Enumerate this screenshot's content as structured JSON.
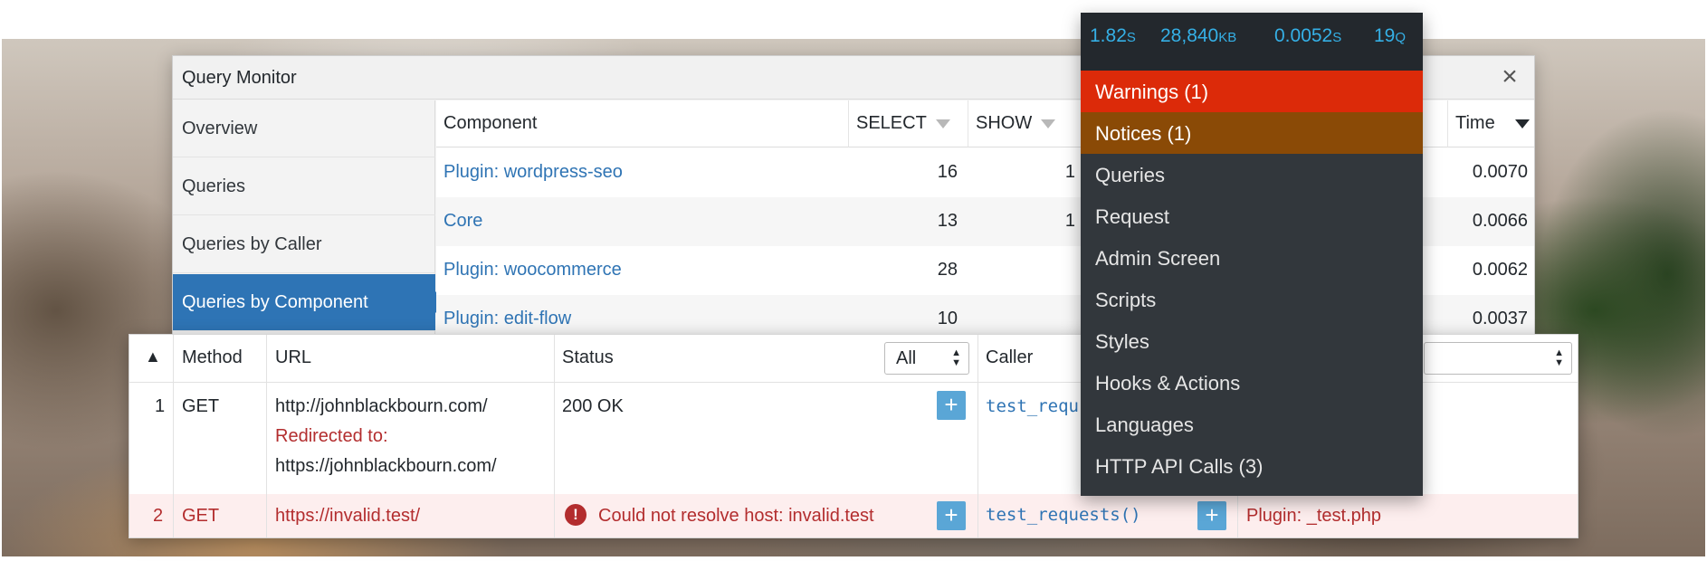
{
  "panel": {
    "title": "Query Monitor",
    "close_icon": "×",
    "nav": [
      {
        "label": "Overview"
      },
      {
        "label": "Queries"
      },
      {
        "label": "Queries by Caller"
      },
      {
        "label": "Queries by Component",
        "active": true
      }
    ],
    "table": {
      "columns": [
        "Component",
        "SELECT",
        "SHOW",
        "Time"
      ],
      "rows": [
        {
          "component": "Plugin: wordpress-seo",
          "select": "16",
          "show": "1",
          "time": "0.0070"
        },
        {
          "component": "Core",
          "select": "13",
          "show": "1",
          "time": "0.0066"
        },
        {
          "component": "Plugin: woocommerce",
          "select": "28",
          "show": "",
          "time": "0.0062"
        },
        {
          "component": "Plugin: edit-flow",
          "select": "10",
          "show": "",
          "time": "0.0037"
        }
      ]
    }
  },
  "http": {
    "sort_icon": "▲",
    "columns": {
      "method": "Method",
      "url": "URL",
      "status": "Status",
      "caller": "Caller"
    },
    "status_filter": "All",
    "plus_label": "+",
    "rows": [
      {
        "index": "1",
        "method": "GET",
        "url": "http://johnblackbourn.com/",
        "redirect_label": "Redirected to:",
        "redirect_url": "https://johnblackbourn.com/",
        "status": "200 OK",
        "caller": "test_requ"
      },
      {
        "index": "2",
        "method": "GET",
        "url": "https://invalid.test/",
        "error_icon": "!",
        "status": "Could not resolve host: invalid.test",
        "caller": "test_requests()",
        "component": "Plugin: _test.php"
      }
    ]
  },
  "admin_menu": {
    "stats": [
      {
        "value": "1.82",
        "unit": "S"
      },
      {
        "value": "28,840",
        "unit": "KB"
      },
      {
        "value": "0.0052",
        "unit": "S"
      },
      {
        "value": "19",
        "unit": "Q"
      }
    ],
    "items": [
      {
        "label": "Warnings (1)",
        "kind": "warn"
      },
      {
        "label": "Notices (1)",
        "kind": "notice"
      },
      {
        "label": "Queries"
      },
      {
        "label": "Request"
      },
      {
        "label": "Admin Screen"
      },
      {
        "label": "Scripts"
      },
      {
        "label": "Styles"
      },
      {
        "label": "Hooks & Actions"
      },
      {
        "label": "Languages"
      },
      {
        "label": "HTTP API Calls (3)"
      }
    ],
    "colors": {
      "stat_text": "#35b0e6",
      "warning_bg": "#dc2a09",
      "notice_bg": "#8a4a06",
      "menu_bg": "#32373c",
      "active_nav": "#2e74b5"
    }
  }
}
